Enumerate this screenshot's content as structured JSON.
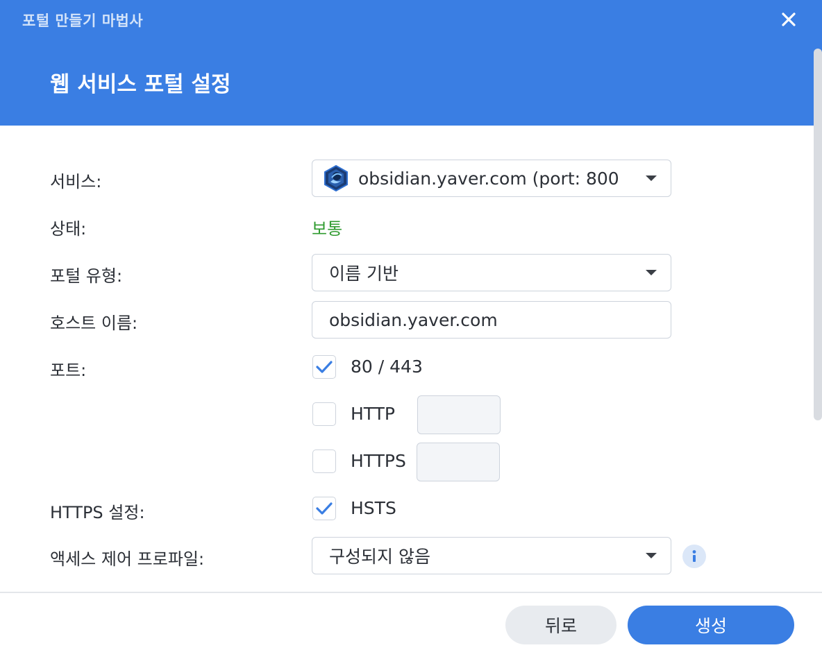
{
  "header": {
    "wizard_title": "포털 만들기 마법사",
    "page_heading": "웹 서비스 포털 설정",
    "accent_color": "#3a7ee3"
  },
  "form": {
    "service": {
      "label": "서비스:",
      "value": "obsidian.yaver.com (port: 800",
      "icon": "obsidian-app-icon"
    },
    "status": {
      "label": "상태:",
      "value": "보통",
      "color": "#2f9b2f"
    },
    "portal_type": {
      "label": "포털 유형:",
      "value": "이름 기반"
    },
    "hostname": {
      "label": "호스트 이름:",
      "value": "obsidian.yaver.com"
    },
    "port": {
      "label": "포트:",
      "options": [
        {
          "label": "80 / 443",
          "checked": true
        },
        {
          "label": "HTTP",
          "checked": false,
          "value": ""
        },
        {
          "label": "HTTPS",
          "checked": false,
          "value": ""
        }
      ]
    },
    "https_settings": {
      "label": "HTTPS 설정:",
      "option": {
        "label": "HSTS",
        "checked": true
      }
    },
    "access_profile": {
      "label": "액세스 제어 프로파일:",
      "value": "구성되지 않음",
      "info_icon": "info-icon"
    }
  },
  "footer": {
    "back_label": "뒤로",
    "create_label": "생성"
  }
}
